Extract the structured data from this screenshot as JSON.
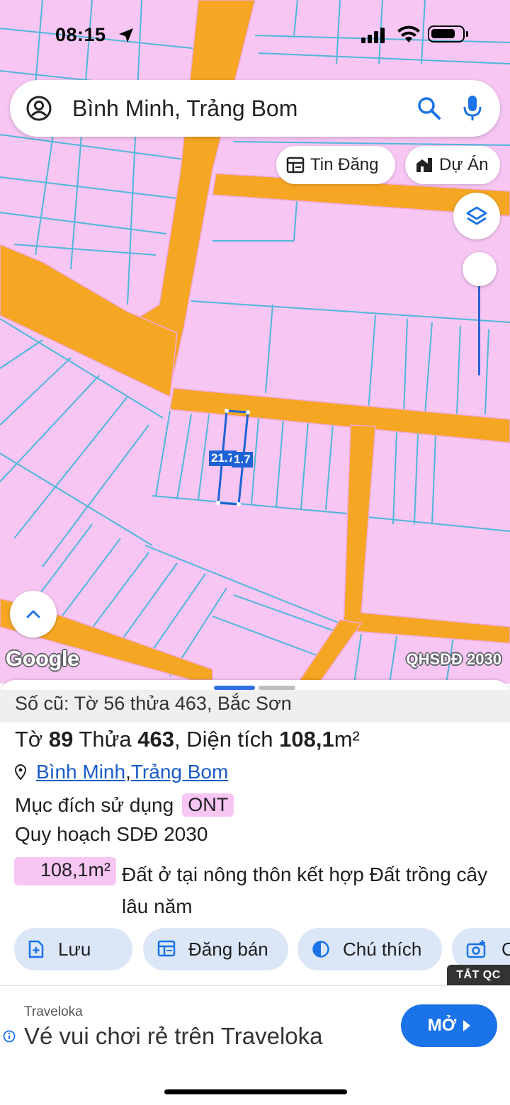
{
  "status_bar": {
    "time": "08:15"
  },
  "search": {
    "text": "Bình Minh, Trảng Bom"
  },
  "chips": {
    "tin_dang": "Tin Đăng",
    "du_an": "Dự Án"
  },
  "map": {
    "logo": "Google",
    "layer_label": "QHSDĐ 2030",
    "dim_left": "21.7",
    "dim_right": "1.7",
    "colors": {
      "land": "#f7c6f3",
      "road": "#f5a623",
      "parcel_line": "#4fb7d9",
      "selection": "#1e63d6"
    }
  },
  "sheet": {
    "old_number": "Số cũ: Tờ 56 thửa 463, Bắc Sơn",
    "title_pre": "Tờ ",
    "sheet_no": "89",
    "title_mid": " Thửa ",
    "parcel_no": "463",
    "title_mid2": ", Diện tích ",
    "area": "108,1",
    "area_unit": "m²",
    "address_1": "Bình Minh",
    "address_sep": ", ",
    "address_2": "Trảng Bom",
    "purpose_label": "Mục đích sử dụng",
    "purpose_code": "ONT",
    "plan_label": "Quy hoạch SDĐ 2030",
    "plan_area": "108,1m²",
    "plan_desc": "Đất ở tại nông thôn kết hợp Đất trồng cây lâu năm"
  },
  "actions": {
    "save": "Lưu",
    "sell": "Đăng bán",
    "legend": "Chú thích",
    "capture": "C"
  },
  "ad": {
    "off_label": "TẮT QC",
    "brand": "Traveloka",
    "headline": "Vé vui chơi rẻ trên Traveloka",
    "cta": "MỞ"
  }
}
